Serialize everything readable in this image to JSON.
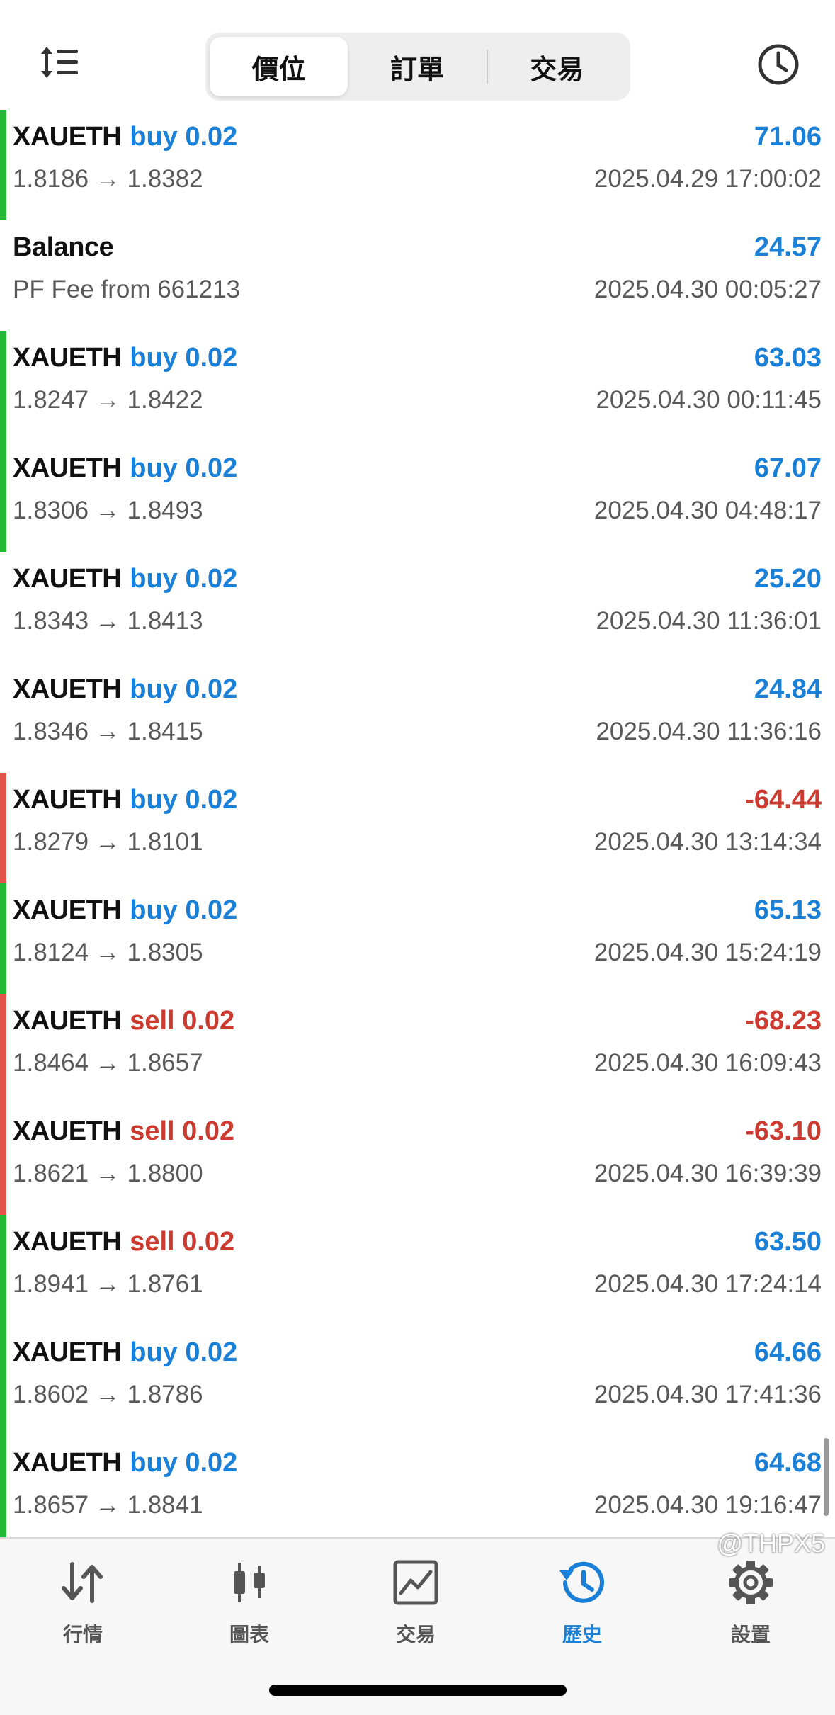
{
  "header": {
    "segments": [
      {
        "label": "價位",
        "active": true
      },
      {
        "label": "訂單",
        "active": false
      },
      {
        "label": "交易",
        "active": false
      }
    ],
    "sort_icon": "sort-icon",
    "history_icon": "clock-icon"
  },
  "colors": {
    "profit_positive": "#1a7fd6",
    "profit_negative": "#cc3b30",
    "bar_green": "#23b832",
    "bar_red": "#e0524a",
    "tab_active": "#1a7fd6"
  },
  "deals": [
    {
      "symbol": "XAUETH",
      "side": "buy 0.02",
      "side_type": "buy",
      "profit": "71.06",
      "profit_type": "pos",
      "prices": "1.8186 → 1.8382",
      "time": "2025.04.29 17:00:02",
      "bar": "green"
    },
    {
      "symbol": "Balance",
      "side": "",
      "side_type": "",
      "profit": "24.57",
      "profit_type": "pos",
      "prices": "PF Fee from 661213",
      "time": "2025.04.30 00:05:27",
      "bar": "none"
    },
    {
      "symbol": "XAUETH",
      "side": "buy 0.02",
      "side_type": "buy",
      "profit": "63.03",
      "profit_type": "pos",
      "prices": "1.8247 → 1.8422",
      "time": "2025.04.30 00:11:45",
      "bar": "green"
    },
    {
      "symbol": "XAUETH",
      "side": "buy 0.02",
      "side_type": "buy",
      "profit": "67.07",
      "profit_type": "pos",
      "prices": "1.8306 → 1.8493",
      "time": "2025.04.30 04:48:17",
      "bar": "green"
    },
    {
      "symbol": "XAUETH",
      "side": "buy 0.02",
      "side_type": "buy",
      "profit": "25.20",
      "profit_type": "pos",
      "prices": "1.8343 → 1.8413",
      "time": "2025.04.30 11:36:01",
      "bar": "none"
    },
    {
      "symbol": "XAUETH",
      "side": "buy 0.02",
      "side_type": "buy",
      "profit": "24.84",
      "profit_type": "pos",
      "prices": "1.8346 → 1.8415",
      "time": "2025.04.30 11:36:16",
      "bar": "none"
    },
    {
      "symbol": "XAUETH",
      "side": "buy 0.02",
      "side_type": "buy",
      "profit": "-64.44",
      "profit_type": "neg",
      "prices": "1.8279 → 1.8101",
      "time": "2025.04.30 13:14:34",
      "bar": "red"
    },
    {
      "symbol": "XAUETH",
      "side": "buy 0.02",
      "side_type": "buy",
      "profit": "65.13",
      "profit_type": "pos",
      "prices": "1.8124 → 1.8305",
      "time": "2025.04.30 15:24:19",
      "bar": "green"
    },
    {
      "symbol": "XAUETH",
      "side": "sell 0.02",
      "side_type": "sell",
      "profit": "-68.23",
      "profit_type": "neg",
      "prices": "1.8464 → 1.8657",
      "time": "2025.04.30 16:09:43",
      "bar": "red"
    },
    {
      "symbol": "XAUETH",
      "side": "sell 0.02",
      "side_type": "sell",
      "profit": "-63.10",
      "profit_type": "neg",
      "prices": "1.8621 → 1.8800",
      "time": "2025.04.30 16:39:39",
      "bar": "red"
    },
    {
      "symbol": "XAUETH",
      "side": "sell 0.02",
      "side_type": "sell",
      "profit": "63.50",
      "profit_type": "pos",
      "prices": "1.8941 → 1.8761",
      "time": "2025.04.30 17:24:14",
      "bar": "green"
    },
    {
      "symbol": "XAUETH",
      "side": "buy 0.02",
      "side_type": "buy",
      "profit": "64.66",
      "profit_type": "pos",
      "prices": "1.8602 → 1.8786",
      "time": "2025.04.30 17:41:36",
      "bar": "green"
    },
    {
      "symbol": "XAUETH",
      "side": "buy 0.02",
      "side_type": "buy",
      "profit": "64.68",
      "profit_type": "pos",
      "prices": "1.8657 → 1.8841",
      "time": "2025.04.30 19:16:47",
      "bar": "green"
    }
  ],
  "tabs": [
    {
      "label": "行情",
      "icon": "arrows-updown-icon",
      "active": false
    },
    {
      "label": "圖表",
      "icon": "candlestick-icon",
      "active": false
    },
    {
      "label": "交易",
      "icon": "trade-chart-icon",
      "active": false
    },
    {
      "label": "歷史",
      "icon": "history-clock-icon",
      "active": true
    },
    {
      "label": "設置",
      "icon": "gear-icon",
      "active": false
    }
  ],
  "watermark": "@THPX5"
}
